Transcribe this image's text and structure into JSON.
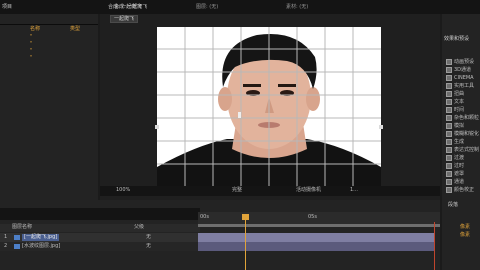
{
  "project": {
    "tab_label": "项目",
    "header_label": "名称",
    "header_right": "类型",
    "items": [
      "\"",
      "\"",
      "\"",
      "\""
    ]
  },
  "composition": {
    "tab_label": "合成: 一起爬飞",
    "layer_tab": "图层: (无)",
    "footage_tab": "素材: (无)",
    "subtab": "一起爬飞"
  },
  "viewer_bar": {
    "zoom": "100%",
    "resolution": "完整",
    "view": "活动摄像机",
    "views": "1..."
  },
  "effects_panel": {
    "title": "效果和预设",
    "items": [
      "动画预设",
      "3D通道",
      "CINEMA",
      "实用工具",
      "扭曲",
      "文本",
      "时间",
      "杂色和颗粒",
      "模拟",
      "模糊和锐化",
      "生成",
      "表达式控制",
      "过渡",
      "过时",
      "遮罩",
      "通道",
      "颜色校正",
      "音频",
      "风格化",
      "全部"
    ]
  },
  "right_bottom": {
    "title": "段落",
    "rows": [
      "像素",
      "像素"
    ]
  },
  "timeline": {
    "columns": [
      "图层名称",
      "父级"
    ],
    "layers": [
      {
        "index": "1",
        "name": "[一起爬飞.jpg]",
        "parent": "无"
      },
      {
        "index": "2",
        "name": "[水波纹图层.jpg]",
        "parent": "无"
      }
    ],
    "ruler_start": "00s",
    "ruler_mid": "05s"
  },
  "colors": {
    "accent": "#e0a33a",
    "selection": "#5a6fa8",
    "timebar": "#6a6a86"
  }
}
